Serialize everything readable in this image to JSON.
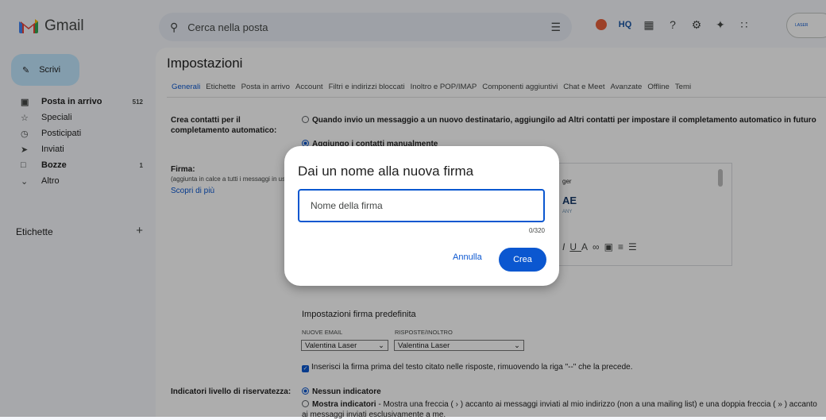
{
  "app": {
    "name": "Gmail"
  },
  "search": {
    "placeholder": "Cerca nella posta"
  },
  "compose": {
    "label": "Scrivi"
  },
  "sidebar": {
    "items": [
      {
        "label": "Posta in arrivo",
        "count": "512",
        "icon": "inbox-icon",
        "bold": true
      },
      {
        "label": "Speciali",
        "count": "",
        "icon": "star-icon"
      },
      {
        "label": "Posticipati",
        "count": "",
        "icon": "clock-icon"
      },
      {
        "label": "Inviati",
        "count": "",
        "icon": "send-icon"
      },
      {
        "label": "Bozze",
        "count": "1",
        "icon": "draft-icon",
        "bold": true
      },
      {
        "label": "Altro",
        "count": "",
        "icon": "chevron-down-icon"
      }
    ],
    "labels_title": "Etichette",
    "labels_add": "+"
  },
  "page": {
    "title": "Impostazioni"
  },
  "tabs": [
    "Generali",
    "Etichette",
    "Posta in arrivo",
    "Account",
    "Filtri e indirizzi bloccati",
    "Inoltro e POP/IMAP",
    "Componenti aggiuntivi",
    "Chat e Meet",
    "Avanzate",
    "Offline",
    "Temi"
  ],
  "contacts": {
    "label": "Crea contatti per il completamento automatico:",
    "opt1": "Quando invio un messaggio a un nuovo destinatario, aggiungilo ad Altri contatti per impostare il completamento automatico in futuro",
    "opt2": "Aggiungo i contatti manualmente"
  },
  "signature": {
    "label": "Firma:",
    "sub": "(aggiunta in calce a tutti i messaggi in uscita)",
    "link": "Scopri di più",
    "preview_frag1": "ger",
    "preview_frag2": "AE",
    "preview_frag3": "ANY"
  },
  "default_sig": {
    "title": "Impostazioni firma predefinita",
    "new_label": "NUOVE EMAIL",
    "reply_label": "RISPOSTE/INOLTRO",
    "new_value": "Valentina Laser",
    "reply_value": "Valentina Laser",
    "checkbox": "Inserisci la firma prima del testo citato nelle risposte, rimuovendo la riga \"--\" che la precede."
  },
  "privacy": {
    "label": "Indicatori livello di riservatezza:",
    "opt1": "Nessun indicatore",
    "opt2_bold": "Mostra indicatori",
    "opt2": " - Mostra una freccia ( › ) accanto ai messaggi inviati al mio indirizzo (non a una mailing list) e una doppia freccia ( » ) accanto ai messaggi inviati esclusivamente a me."
  },
  "dialog": {
    "title": "Dai un nome alla nuova firma",
    "placeholder": "Nome della firma",
    "counter": "0/320",
    "cancel": "Annulla",
    "create": "Crea"
  },
  "account": {
    "logo": "LASER"
  }
}
